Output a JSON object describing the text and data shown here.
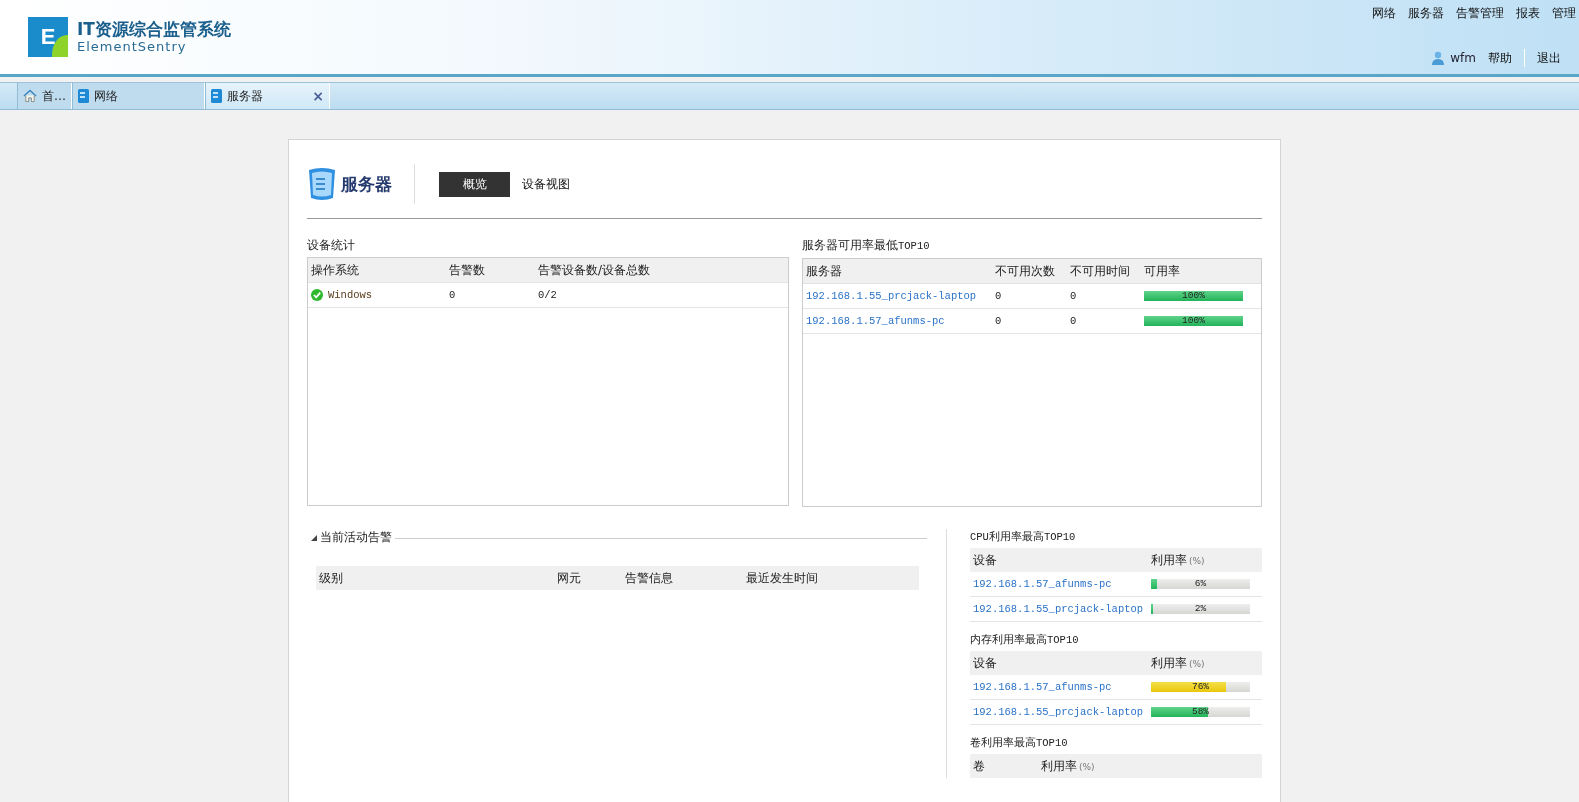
{
  "header": {
    "logo_letter": "E",
    "title": "IT资源综合监管系统",
    "subtitle": "ElementSentry",
    "nav": [
      "网络",
      "服务器",
      "告警管理",
      "报表",
      "管理"
    ],
    "user": "wfm",
    "links": [
      "帮助",
      "退出"
    ]
  },
  "tabs": [
    {
      "label": "首…",
      "kind": "home",
      "selected": false
    },
    {
      "label": "网络",
      "kind": "module",
      "selected": false
    },
    {
      "label": "服务器",
      "kind": "module",
      "selected": true,
      "close": "×"
    }
  ],
  "page": {
    "title": "服务器",
    "views": [
      {
        "label": "概览",
        "selected": true
      },
      {
        "label": "设备视图",
        "selected": false
      }
    ]
  },
  "device_stats": {
    "title": "设备统计",
    "columns": [
      "操作系统",
      "告警数",
      "告警设备数/设备总数"
    ],
    "rows": [
      {
        "os": "Windows",
        "healthy": true,
        "alarms": "0",
        "ratio": "0/2"
      }
    ]
  },
  "availability": {
    "title": "服务器可用率最低",
    "title_suffix": "TOP10",
    "columns": [
      "服务器",
      "不可用次数",
      "不可用时间",
      "可用率"
    ],
    "rows": [
      {
        "server": "192.168.1.55_prcjack-laptop",
        "count": "0",
        "time": "0",
        "rate": "100%",
        "level": 1
      },
      {
        "server": "192.168.1.57_afunms-pc",
        "count": "0",
        "time": "0",
        "rate": "100%",
        "level": 1
      }
    ]
  },
  "active_alarms": {
    "title": "当前活动告警",
    "columns": [
      "级别",
      "网元",
      "告警信息",
      "最近发生时间"
    ]
  },
  "usage_tops": [
    {
      "prefix": "CPU",
      "title": "利用率最高",
      "suffix": "TOP10",
      "columns": [
        {
          "label": "设备"
        },
        {
          "label": "利用率",
          "unit": "(%)"
        }
      ],
      "rows": [
        {
          "device": "192.168.1.57_afunms-pc",
          "value": "6%",
          "level": 0.06
        },
        {
          "device": "192.168.1.55_prcjack-laptop",
          "value": "2%",
          "level": 0.02
        }
      ]
    },
    {
      "title": "内存利用率最高",
      "suffix": "TOP10",
      "columns": [
        {
          "label": "设备"
        },
        {
          "label": "利用率",
          "unit": "(%)"
        }
      ],
      "rows": [
        {
          "device": "192.168.1.57_afunms-pc",
          "value": "76%",
          "level": 0.76
        },
        {
          "device": "192.168.1.55_prcjack-laptop",
          "value": "58%",
          "level": 0.58
        }
      ]
    },
    {
      "title": "卷利用率最高",
      "suffix": "TOP10",
      "columns": [
        {
          "label": "卷"
        },
        {
          "label": "利用率",
          "unit": "(%)"
        }
      ]
    }
  ]
}
